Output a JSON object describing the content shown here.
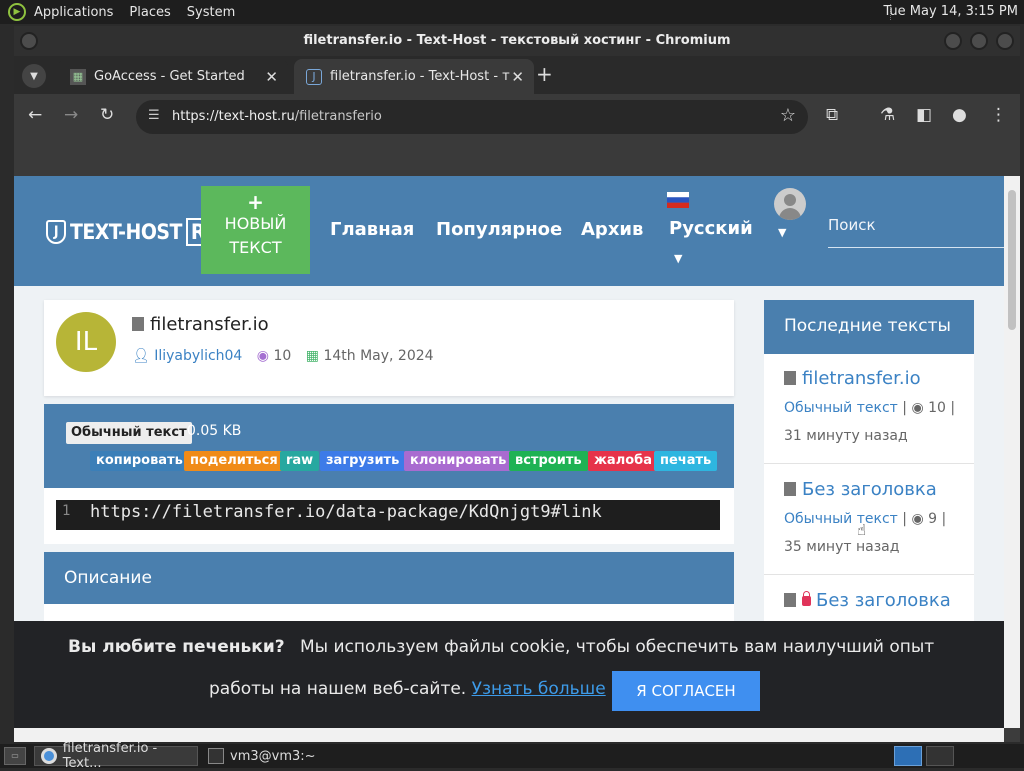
{
  "top_panel": {
    "menus": [
      "Applications",
      "Places",
      "System"
    ],
    "clock": "Tue May 14,  3:15 PM"
  },
  "window": {
    "title": "filetransfer.io - Text-Host - текстовый хостинг - Chromium"
  },
  "tabs": [
    {
      "label": "GoAccess - Get Started"
    },
    {
      "label": "filetransfer.io - Text-Host - т"
    }
  ],
  "toolbar": {
    "url_host": "https://text-host.ru",
    "url_path": "/filetransferio"
  },
  "site": {
    "logo": "TEXT-HOST",
    "logo_suffix": "RU",
    "new_text_button": [
      "НОВЫЙ",
      "ТЕКСТ"
    ],
    "nav": [
      "Главная",
      "Популярное",
      "Архив"
    ],
    "language": "Русский",
    "search_placeholder": "Поиск"
  },
  "paste": {
    "initials": "IL",
    "title": "filetransfer.io",
    "author": "Iliyabylich04",
    "views": "10",
    "date": "14th May, 2024",
    "type": "Обычный текст",
    "size": "0.05 KB",
    "actions": [
      {
        "label": "копировать",
        "color": "#3b7fb8"
      },
      {
        "label": "поделиться",
        "color": "#f08b18"
      },
      {
        "label": "raw",
        "color": "#27a8a0"
      },
      {
        "label": "загрузить",
        "color": "#3d7be8"
      },
      {
        "label": "клонировать",
        "color": "#a96bd0"
      },
      {
        "label": "встроить",
        "color": "#1fb254"
      },
      {
        "label": "жалоба",
        "color": "#e6334a"
      },
      {
        "label": "печать",
        "color": "#2eb6e0"
      }
    ],
    "line_number": "1",
    "code": "https://filetransfer.io/data-package/KdQnjgt9#link",
    "description_title": "Описание"
  },
  "sidebar": {
    "title": "Последние тексты",
    "items": [
      {
        "title": "filetransfer.io",
        "type": "Обычный текст",
        "views": "10",
        "sep": "|",
        "time": "31 минуту назад",
        "locked": false
      },
      {
        "title": "Без заголовка",
        "type": "Обычный текст",
        "views": "9",
        "sep": "|",
        "time": "35 минут назад",
        "locked": false
      },
      {
        "title": "Без заголовка",
        "locked": true
      }
    ]
  },
  "cookie": {
    "heading": "Вы любите печеньки?",
    "text1": "Мы используем файлы cookie, чтобы обеспечить вам наилучший опыт",
    "text2": "работы на нашем веб-сайте.",
    "learn_more": "Узнать больше",
    "accept": "Я СОГЛАСЕН"
  },
  "taskbar": {
    "tasks": [
      "filetransfer.io - Text...",
      "vm3@vm3:~"
    ]
  },
  "colors": {
    "brand_blue": "#4a7fae",
    "green": "#5cb85c",
    "link": "#3b82c4"
  }
}
